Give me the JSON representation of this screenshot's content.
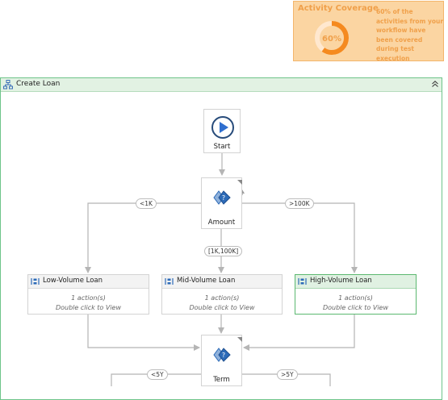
{
  "coverage": {
    "title": "Activity Coverage",
    "percent_label": "60%",
    "percent": 60,
    "description": "60% of the activities from your workflow have been covered during test execution",
    "accent": "#f0a04a",
    "background": "#fbd5a2"
  },
  "container": {
    "title": "Create Loan"
  },
  "nodes": {
    "start": {
      "label": "Start"
    },
    "amount": {
      "label": "Amount"
    },
    "term": {
      "label": "Term"
    }
  },
  "sequences": {
    "low": {
      "title": "Low-Volume Loan",
      "actions": "1 action(s)",
      "hint": "Double click to View"
    },
    "mid": {
      "title": "Mid-Volume Loan",
      "actions": "1 action(s)",
      "hint": "Double click to View"
    },
    "high": {
      "title": "High-Volume Loan",
      "actions": "1 action(s)",
      "hint": "Double click to View"
    }
  },
  "edge_labels": {
    "lt1k": "<1K",
    "gt100k": ">100K",
    "range": "[1K,100K]",
    "lt5y": "<5Y",
    "gt5y": ">5Y"
  },
  "colors": {
    "container_border": "#6ec48a",
    "active_border": "#5bb870",
    "connector": "#b5b5b5",
    "start_blue": "#2f6fcf",
    "switch_blue": "#2d6bb8"
  }
}
